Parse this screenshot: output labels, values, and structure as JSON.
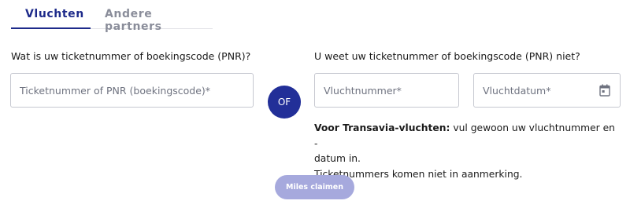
{
  "tabs": [
    {
      "label": "Vluchten",
      "active": true
    },
    {
      "label": "Andere partners",
      "active": false
    }
  ],
  "left": {
    "question": "Wat is uw ticketnummer of boekingscode (PNR)?",
    "ticket_placeholder": "Ticketnummer of PNR (boekingscode)*",
    "ticket_value": ""
  },
  "or_label": "OF",
  "right": {
    "question": "U weet uw ticketnummer of boekingscode (PNR) niet?",
    "flight_number_placeholder": "Vluchtnummer*",
    "flight_number_value": "",
    "flight_date_placeholder": "Vluchtdatum*",
    "flight_date_value": "",
    "calendar_icon": "calendar-icon"
  },
  "info": {
    "bold": "Voor Transavia-vluchten:",
    "text_1": " vul gewoon uw vluchtnummer en -",
    "text_2": "datum in.",
    "text_3": "Ticketnummers komen niet in aanmerking."
  },
  "submit_label": "Miles claimen",
  "colors": {
    "primary": "#222f98",
    "tab_active": "#1d2a8a",
    "tab_inactive": "#8a8d9a",
    "button_disabled": "#a6a9dd",
    "border": "#c6c8d0"
  }
}
